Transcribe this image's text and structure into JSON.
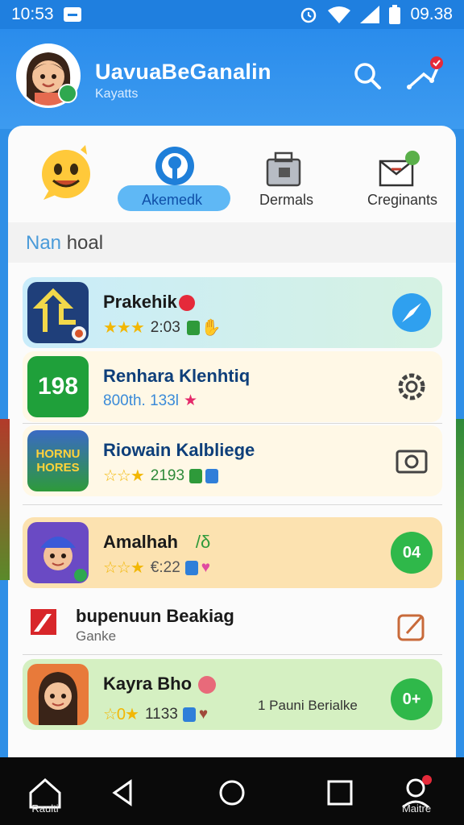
{
  "status_bar": {
    "time_left": "10:53",
    "time_right": "09.38"
  },
  "header": {
    "title": "UavuaBeGanalin",
    "subtitle": "Kayatts"
  },
  "tabs": [
    {
      "label": "Akemedk",
      "active": true,
      "icon": "pin-icon"
    },
    {
      "label": "Dermals",
      "active": false,
      "icon": "toolbox-icon"
    },
    {
      "label": "Creginants",
      "active": false,
      "icon": "gift-icon"
    }
  ],
  "section": {
    "title_part1": "Nan",
    "title_part2": " hoal"
  },
  "rows": [
    {
      "title": "Prakehik",
      "rating_text": "2:03",
      "bg": "#d6f0f4",
      "action": "compass-icon",
      "icon_text": ""
    },
    {
      "title": "Renhara Klenhtiq",
      "rating_text": "800th. 133l",
      "bg": "#fff7e6",
      "action": "gear-icon",
      "icon_text": "198"
    },
    {
      "title": "Riowain Kalbliege",
      "rating_text": "2193",
      "bg": "#fff7e6",
      "action": "camera-icon",
      "icon_text": "HORNU HORES"
    },
    {
      "title": "Amalhah",
      "title_suffix": "/δ",
      "rating_text": "€:22",
      "bg": "#fce3b2",
      "action": "badge-icon",
      "action_text": "04"
    },
    {
      "title": "bupenuun Beakiag",
      "subtitle": "Ganke",
      "bg": "#fbfbfb",
      "action": "edit-icon"
    },
    {
      "title": "Kayra Bho",
      "rating_text": "1133",
      "bg": "#d7f0c4",
      "action": "badge-icon",
      "action_text": "0+",
      "side_text": "1 Pauni Berialke"
    }
  ],
  "nav": {
    "home_label": "Raulti",
    "profile_label": "Maitre"
  }
}
